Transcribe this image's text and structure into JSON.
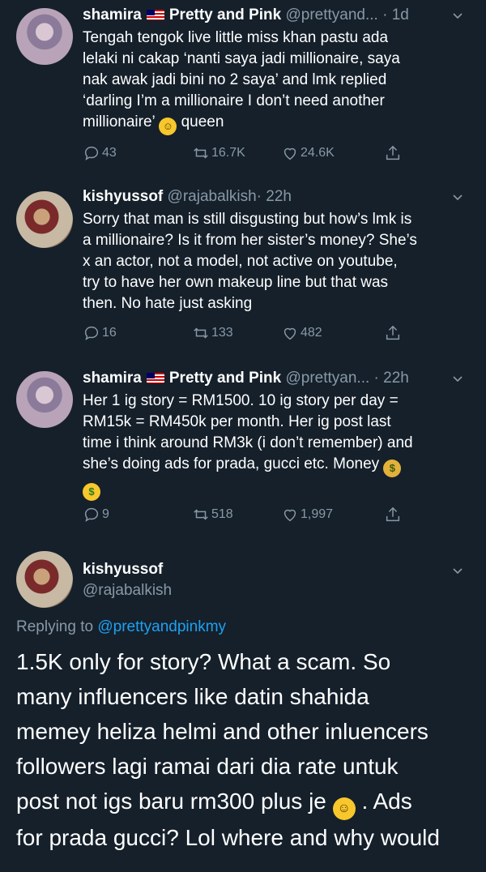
{
  "tweets": [
    {
      "name": "shamira",
      "display": "Pretty and Pink",
      "handle": "@prettyand...",
      "sep": "·",
      "time": "1d",
      "text_lines": [
        "Tengah tengok live little miss khan pastu ada",
        "lelaki ni cakap ‘nanti saya jadi millionaire, saya",
        "nak awak jadi bini no 2 saya’ and lmk replied",
        "‘darling I’m a millionaire I don’t need another"
      ],
      "last_line_pre": "millionaire’",
      "last_line_post": "queen",
      "replies": "43",
      "retweets": "16.7K",
      "likes": "24.6K"
    },
    {
      "name": "kishyussof",
      "handle": "@rajabalkish",
      "sep": "·",
      "time": "22h",
      "text_lines": [
        "Sorry that man is still disgusting but how’s lmk is",
        "a millionaire? Is it from her sister’s money? She’s",
        "x an actor, not a model, not active on youtube,",
        "try to have her own makeup line but that was",
        "then. No hate just asking"
      ],
      "replies": "16",
      "retweets": "133",
      "likes": "482"
    },
    {
      "name": "shamira",
      "display": "Pretty and Pink",
      "handle": "@prettyan...",
      "sep": "·",
      "time": "22h",
      "text_lines": [
        "Her 1 ig story = RM1500. 10 ig story per day =",
        "RM15k = RM450k per month. Her ig post last",
        "time i think around RM3k (i don’t remember) and"
      ],
      "line4_pre": "she’s doing ads for prada, gucci etc. Money",
      "replies": "9",
      "retweets": "518",
      "likes": "1,997"
    }
  ],
  "main_tweet": {
    "name": "kishyussof",
    "handle": "@rajabalkish",
    "replying_label": "Replying to",
    "replying_to": "@prettyandpinkmy",
    "lines": [
      "1.5K only for story? What a scam. So",
      "many influencers like datin shahida",
      "memey heliza helmi and other inluencers",
      "followers lagi ramai dari dia rate untuk"
    ],
    "line5_pre": "post not igs baru rm300 plus je",
    "line5_post": ". Ads",
    "line6": "for prada gucci? Lol where and why would"
  },
  "icons": {
    "reply": "reply-icon",
    "retweet": "retweet-icon",
    "like": "heart-icon",
    "share": "share-icon",
    "more": "chevron-down-icon"
  }
}
